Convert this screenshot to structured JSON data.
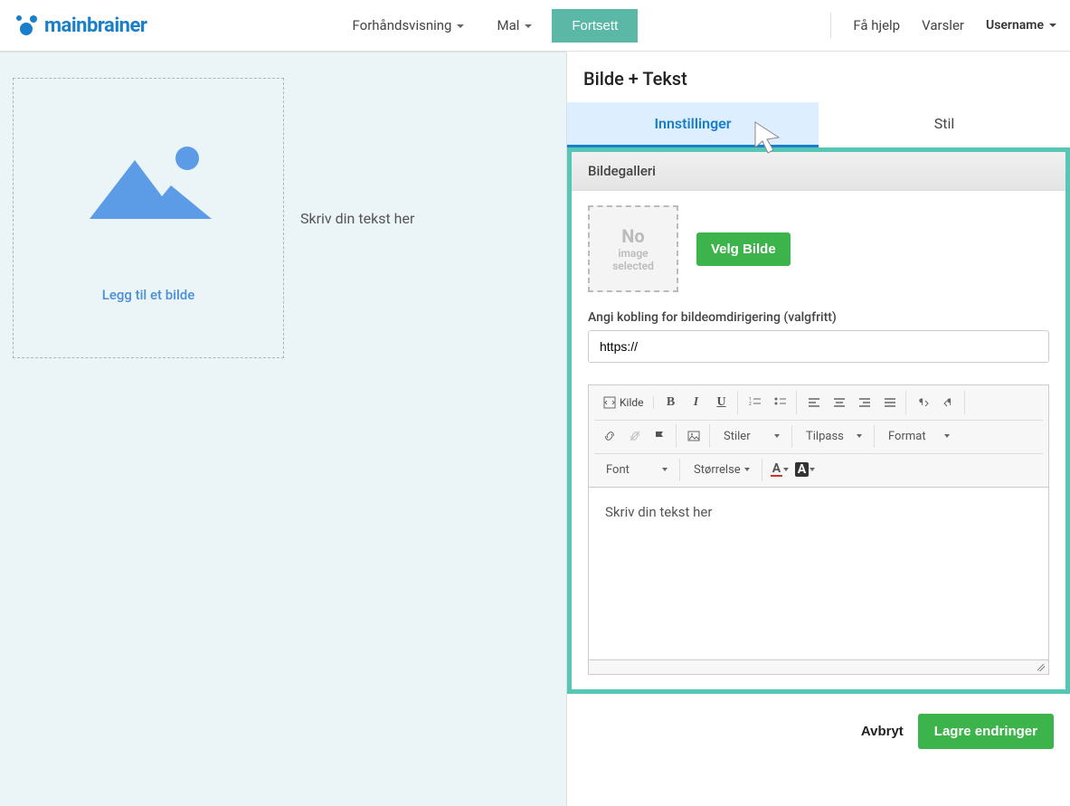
{
  "header": {
    "logo_text": "mainbrainer",
    "nav": {
      "preview": "Forhåndsvisning",
      "template": "Mal",
      "continue": "Fortsett"
    },
    "right": {
      "help": "Få hjelp",
      "alerts": "Varsler",
      "username": "Username"
    }
  },
  "canvas": {
    "add_image": "Legg til et bilde",
    "text_placeholder": "Skriv din tekst her"
  },
  "sidebar": {
    "title": "Bilde + Tekst",
    "tabs": {
      "settings": "Innstillinger",
      "style": "Stil"
    },
    "gallery": {
      "heading": "Bildegalleri",
      "no": "No",
      "no_sub": "image\nselected",
      "select_image": "Velg Bilde",
      "link_label": "Angi kobling for bildeomdirigering (valgfritt)",
      "link_value": "https://"
    },
    "editor": {
      "source": "Kilde",
      "styles": "Stiler",
      "fit": "Tilpass",
      "format": "Format",
      "font": "Font",
      "size": "Størrelse",
      "body": "Skriv din tekst her"
    },
    "footer": {
      "cancel": "Avbryt",
      "save": "Lagre endringer"
    }
  }
}
